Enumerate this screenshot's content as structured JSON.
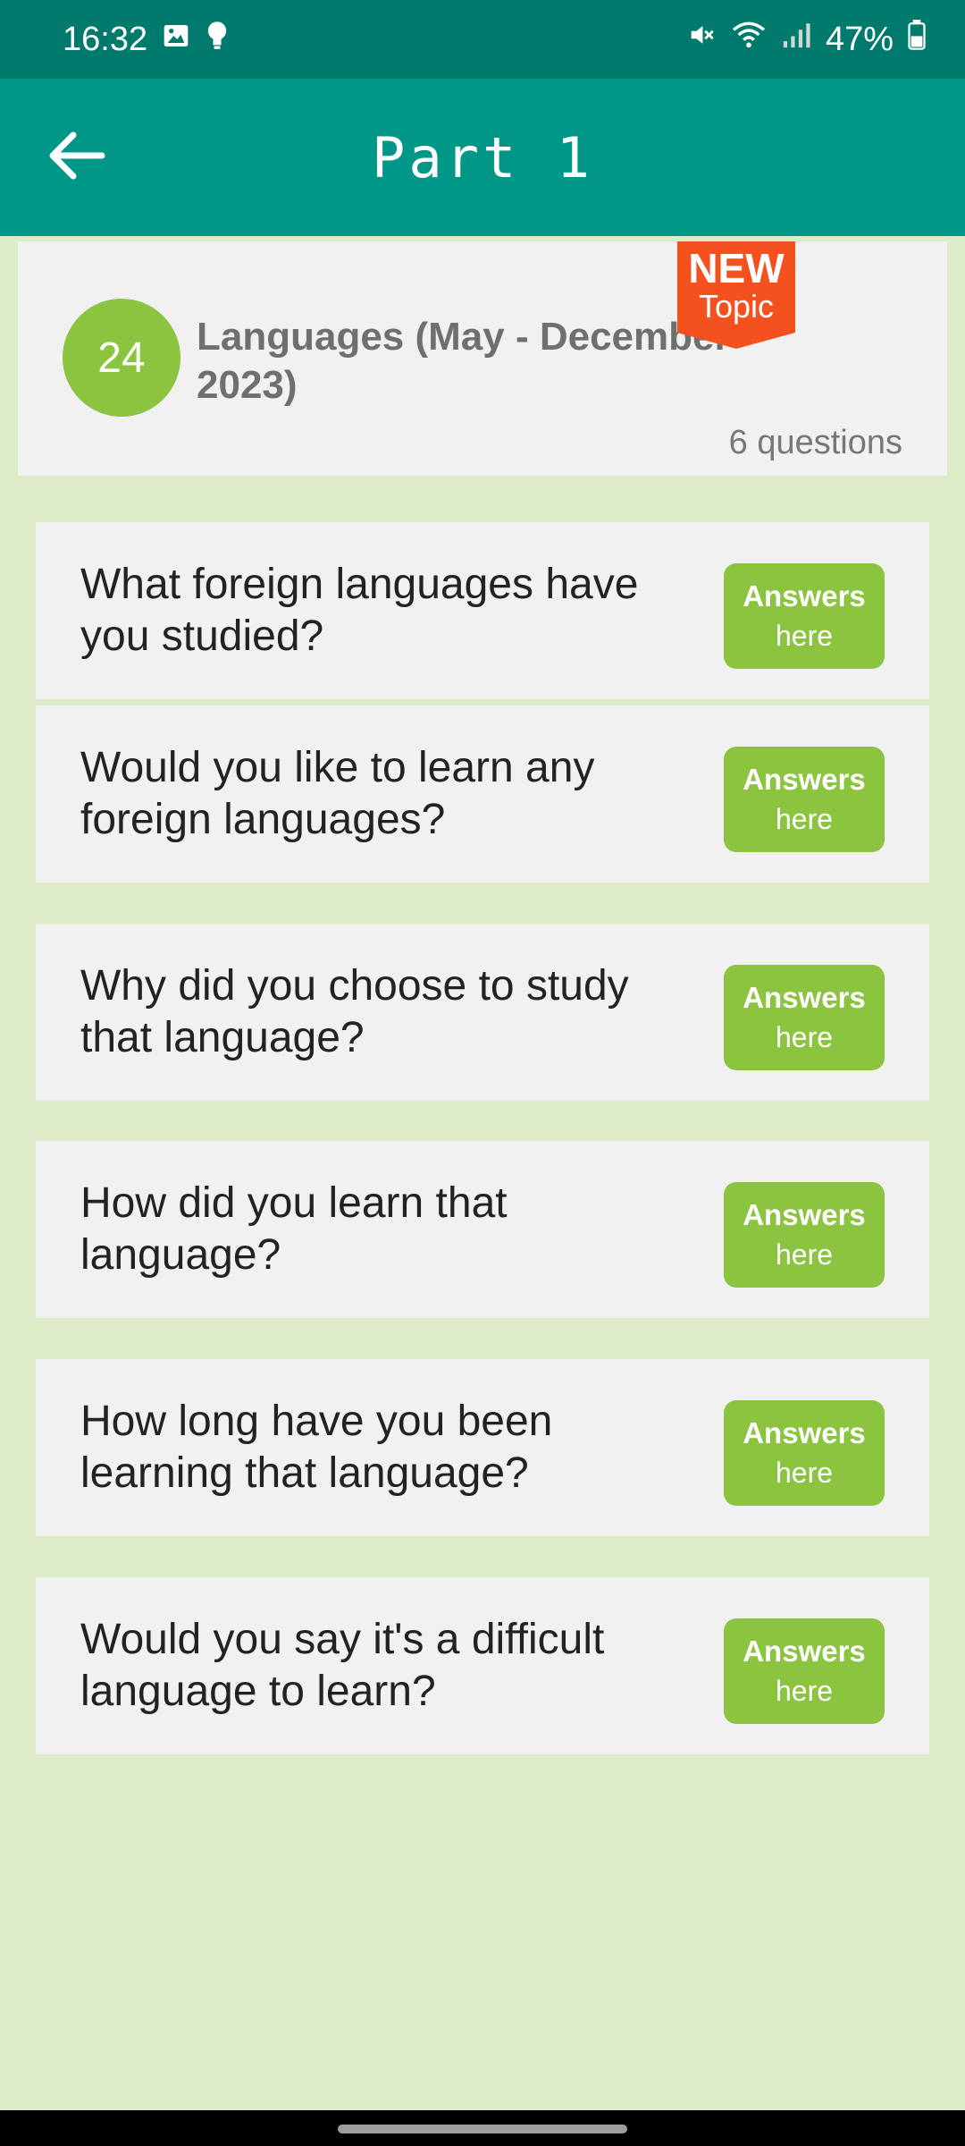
{
  "status_bar": {
    "time": "16:32",
    "battery": "47%",
    "icons": [
      "gallery-icon",
      "bulb-icon",
      "mute-icon",
      "wifi-icon",
      "signal-icon",
      "battery-icon"
    ]
  },
  "app_bar": {
    "title": "Part 1",
    "back_icon": "arrow-left-icon"
  },
  "topic": {
    "number": "24",
    "title": "Languages (May - December 2023)",
    "count": "6 questions",
    "badge": {
      "line1": "NEW",
      "line2": "Topic"
    }
  },
  "questions": [
    {
      "text": "What foreign languages have you studied?",
      "button_line1": "Answers",
      "button_line2": "here"
    },
    {
      "text": "Would you like to learn any foreign languages?",
      "button_line1": "Answers",
      "button_line2": "here"
    },
    {
      "text": "Why did you choose to study that language?",
      "button_line1": "Answers",
      "button_line2": "here"
    },
    {
      "text": "How did you learn that language?",
      "button_line1": "Answers",
      "button_line2": "here"
    },
    {
      "text": "How long have you been learning that language?",
      "button_line1": "Answers",
      "button_line2": "here"
    },
    {
      "text": "Would you say it's a difficult language to learn?",
      "button_line1": "Answers",
      "button_line2": "here"
    }
  ],
  "colors": {
    "status_bar": "#007a6c",
    "app_bar": "#009688",
    "background": "#deebc9",
    "card": "#f1f1f1",
    "accent_green": "#8bc43f",
    "badge_orange": "#f4511e"
  }
}
